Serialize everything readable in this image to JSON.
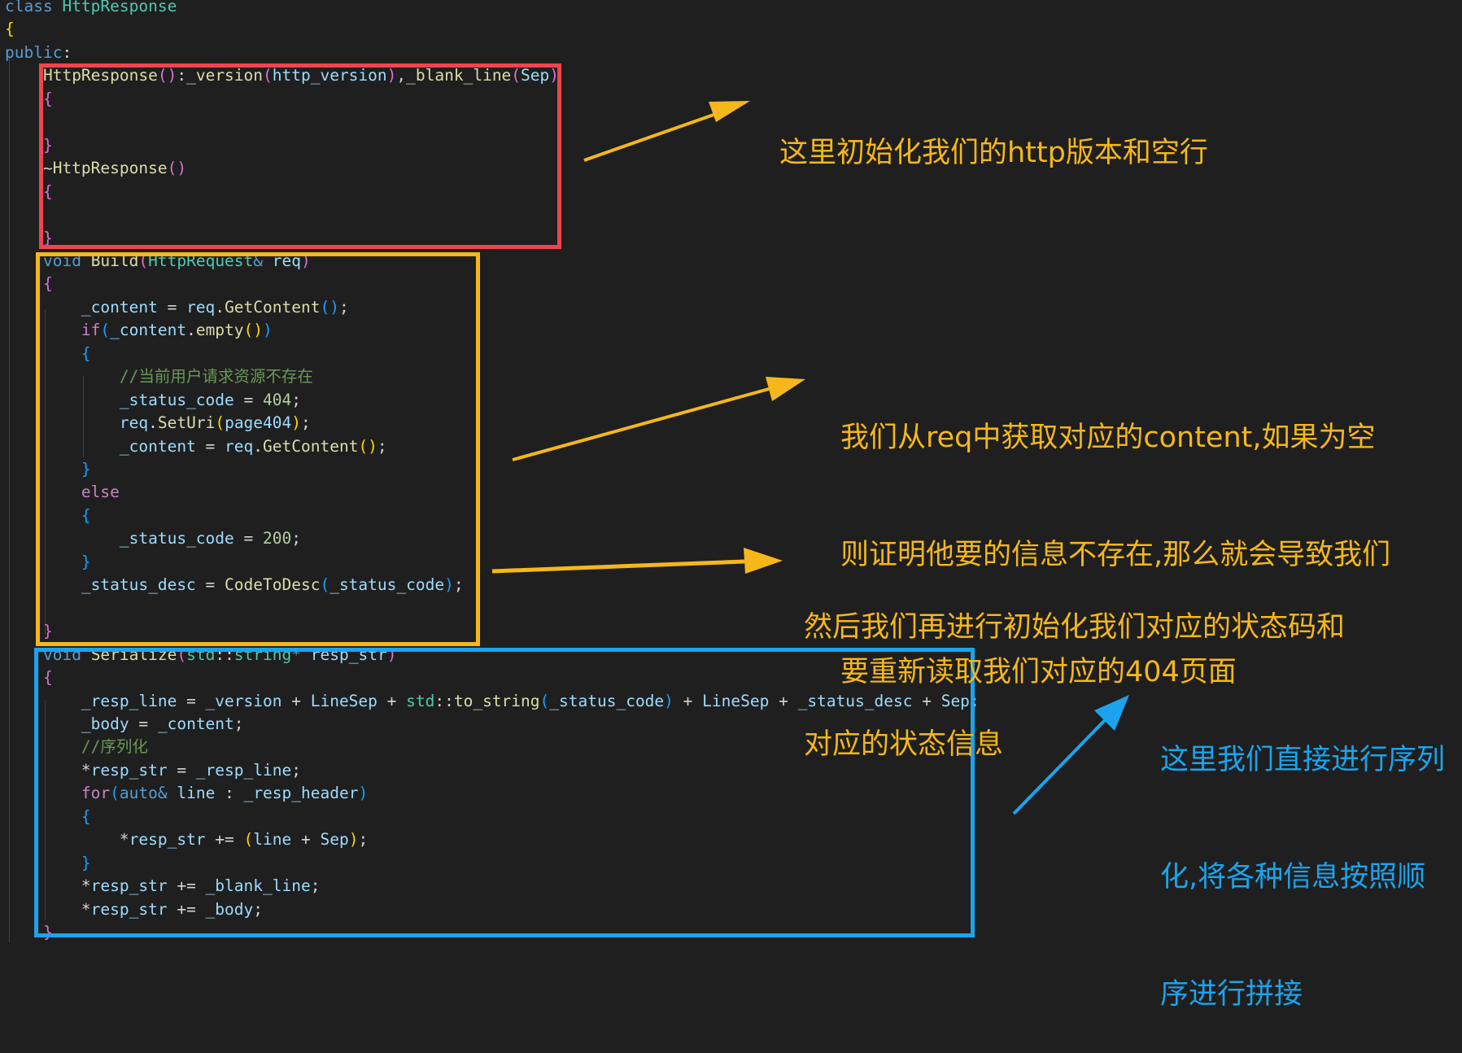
{
  "editor": {
    "theme_colors": {
      "background": "#1f1f1f",
      "keyword": "#569cd6",
      "control": "#c586c0",
      "type": "#4ec9b0",
      "function": "#dcdcaa",
      "variable": "#9cdcfe",
      "number": "#b5cea8",
      "comment": "#6a9955",
      "bracket_gold": "#ffd700",
      "bracket_orchid": "#da70d6",
      "bracket_blue": "#179fff"
    },
    "lines": [
      [
        [
          "kw",
          "class"
        ],
        [
          "pl",
          " "
        ],
        [
          "ty",
          "HttpResponse"
        ]
      ],
      [
        [
          "br1",
          "{"
        ]
      ],
      [
        [
          "kw",
          "public"
        ],
        [
          "pl",
          ":"
        ]
      ],
      [
        [
          "pl",
          "    "
        ],
        [
          "fn",
          "HttpResponse"
        ],
        [
          "br2",
          "()"
        ],
        [
          "pl",
          ":"
        ],
        [
          "fn",
          "_version"
        ],
        [
          "br2",
          "("
        ],
        [
          "var",
          "http_version"
        ],
        [
          "br2",
          ")"
        ],
        [
          "pl",
          ","
        ],
        [
          "fn",
          "_blank_line"
        ],
        [
          "br2",
          "("
        ],
        [
          "var",
          "Sep"
        ],
        [
          "br2",
          ")"
        ]
      ],
      [
        [
          "pl",
          "    "
        ],
        [
          "br2",
          "{"
        ]
      ],
      [
        [
          "pl",
          ""
        ]
      ],
      [
        [
          "pl",
          "    "
        ],
        [
          "br2",
          "}"
        ]
      ],
      [
        [
          "pl",
          "    ~"
        ],
        [
          "fn",
          "HttpResponse"
        ],
        [
          "br2",
          "()"
        ]
      ],
      [
        [
          "pl",
          "    "
        ],
        [
          "br2",
          "{"
        ]
      ],
      [
        [
          "pl",
          ""
        ]
      ],
      [
        [
          "pl",
          "    "
        ],
        [
          "br2",
          "}"
        ]
      ],
      [
        [
          "pl",
          "    "
        ],
        [
          "kw",
          "void"
        ],
        [
          "pl",
          " "
        ],
        [
          "fn",
          "Build"
        ],
        [
          "br2",
          "("
        ],
        [
          "ty",
          "HttpRequest"
        ],
        [
          "kw",
          "&"
        ],
        [
          "pl",
          " "
        ],
        [
          "var",
          "req"
        ],
        [
          "br2",
          ")"
        ]
      ],
      [
        [
          "pl",
          "    "
        ],
        [
          "br2",
          "{"
        ]
      ],
      [
        [
          "pl",
          "        "
        ],
        [
          "var",
          "_content"
        ],
        [
          "pl",
          " = "
        ],
        [
          "var",
          "req"
        ],
        [
          "pl",
          "."
        ],
        [
          "fn",
          "GetContent"
        ],
        [
          "br3",
          "()"
        ],
        [
          "pl",
          ";"
        ]
      ],
      [
        [
          "pl",
          "        "
        ],
        [
          "kw2",
          "if"
        ],
        [
          "br3",
          "("
        ],
        [
          "var",
          "_content"
        ],
        [
          "pl",
          "."
        ],
        [
          "fn",
          "empty"
        ],
        [
          "br1",
          "()"
        ],
        [
          "br3",
          ")"
        ]
      ],
      [
        [
          "pl",
          "        "
        ],
        [
          "br3",
          "{"
        ]
      ],
      [
        [
          "pl",
          "            "
        ],
        [
          "cmt",
          "//当前用户请求资源不存在"
        ]
      ],
      [
        [
          "pl",
          "            "
        ],
        [
          "var",
          "_status_code"
        ],
        [
          "pl",
          " = "
        ],
        [
          "num",
          "404"
        ],
        [
          "pl",
          ";"
        ]
      ],
      [
        [
          "pl",
          "            "
        ],
        [
          "var",
          "req"
        ],
        [
          "pl",
          "."
        ],
        [
          "fn",
          "SetUri"
        ],
        [
          "br1",
          "("
        ],
        [
          "var",
          "page404"
        ],
        [
          "br1",
          ")"
        ],
        [
          "pl",
          ";"
        ]
      ],
      [
        [
          "pl",
          "            "
        ],
        [
          "var",
          "_content"
        ],
        [
          "pl",
          " = "
        ],
        [
          "var",
          "req"
        ],
        [
          "pl",
          "."
        ],
        [
          "fn",
          "GetContent"
        ],
        [
          "br1",
          "()"
        ],
        [
          "pl",
          ";"
        ]
      ],
      [
        [
          "pl",
          "        "
        ],
        [
          "br3",
          "}"
        ]
      ],
      [
        [
          "pl",
          "        "
        ],
        [
          "kw2",
          "else"
        ]
      ],
      [
        [
          "pl",
          "        "
        ],
        [
          "br3",
          "{"
        ]
      ],
      [
        [
          "pl",
          "            "
        ],
        [
          "var",
          "_status_code"
        ],
        [
          "pl",
          " = "
        ],
        [
          "num",
          "200"
        ],
        [
          "pl",
          ";"
        ]
      ],
      [
        [
          "pl",
          "        "
        ],
        [
          "br3",
          "}"
        ]
      ],
      [
        [
          "pl",
          "        "
        ],
        [
          "var",
          "_status_desc"
        ],
        [
          "pl",
          " = "
        ],
        [
          "fn",
          "CodeToDesc"
        ],
        [
          "br3",
          "("
        ],
        [
          "var",
          "_status_code"
        ],
        [
          "br3",
          ")"
        ],
        [
          "pl",
          ";"
        ]
      ],
      [
        [
          "pl",
          ""
        ]
      ],
      [
        [
          "pl",
          "    "
        ],
        [
          "br2",
          "}"
        ]
      ],
      [
        [
          "pl",
          "    "
        ],
        [
          "kw",
          "void"
        ],
        [
          "pl",
          " "
        ],
        [
          "fn",
          "Serialize"
        ],
        [
          "br2",
          "("
        ],
        [
          "ty",
          "std"
        ],
        [
          "pl",
          "::"
        ],
        [
          "ty",
          "string"
        ],
        [
          "kw",
          "*"
        ],
        [
          "pl",
          " "
        ],
        [
          "var",
          "resp_str"
        ],
        [
          "br2",
          ")"
        ]
      ],
      [
        [
          "pl",
          "    "
        ],
        [
          "br2",
          "{"
        ]
      ],
      [
        [
          "pl",
          "        "
        ],
        [
          "var",
          "_resp_line"
        ],
        [
          "pl",
          " = "
        ],
        [
          "var",
          "_version"
        ],
        [
          "pl",
          " + "
        ],
        [
          "var",
          "LineSep"
        ],
        [
          "pl",
          " + "
        ],
        [
          "ty",
          "std"
        ],
        [
          "pl",
          "::"
        ],
        [
          "fn",
          "to_string"
        ],
        [
          "br3",
          "("
        ],
        [
          "var",
          "_status_code"
        ],
        [
          "br3",
          ")"
        ],
        [
          "pl",
          " + "
        ],
        [
          "var",
          "LineSep"
        ],
        [
          "pl",
          " + "
        ],
        [
          "var",
          "_status_desc"
        ],
        [
          "pl",
          " + "
        ],
        [
          "var",
          "Sep"
        ],
        [
          "pl",
          ";"
        ]
      ],
      [
        [
          "pl",
          "        "
        ],
        [
          "var",
          "_body"
        ],
        [
          "pl",
          " = "
        ],
        [
          "var",
          "_content"
        ],
        [
          "pl",
          ";"
        ]
      ],
      [
        [
          "pl",
          "        "
        ],
        [
          "cmt",
          "//序列化"
        ]
      ],
      [
        [
          "pl",
          "        *"
        ],
        [
          "var",
          "resp_str"
        ],
        [
          "pl",
          " = "
        ],
        [
          "var",
          "_resp_line"
        ],
        [
          "pl",
          ";"
        ]
      ],
      [
        [
          "pl",
          "        "
        ],
        [
          "kw2",
          "for"
        ],
        [
          "br3",
          "("
        ],
        [
          "kw",
          "auto"
        ],
        [
          "kw",
          "&"
        ],
        [
          "pl",
          " "
        ],
        [
          "var",
          "line"
        ],
        [
          "pl",
          " : "
        ],
        [
          "var",
          "_resp_header"
        ],
        [
          "br3",
          ")"
        ]
      ],
      [
        [
          "pl",
          "        "
        ],
        [
          "br3",
          "{"
        ]
      ],
      [
        [
          "pl",
          "            *"
        ],
        [
          "var",
          "resp_str"
        ],
        [
          "pl",
          " += "
        ],
        [
          "br1",
          "("
        ],
        [
          "var",
          "line"
        ],
        [
          "pl",
          " + "
        ],
        [
          "var",
          "Sep"
        ],
        [
          "br1",
          ")"
        ],
        [
          "pl",
          ";"
        ]
      ],
      [
        [
          "pl",
          "        "
        ],
        [
          "br3",
          "}"
        ]
      ],
      [
        [
          "pl",
          "        *"
        ],
        [
          "var",
          "resp_str"
        ],
        [
          "pl",
          " += "
        ],
        [
          "var",
          "_blank_line"
        ],
        [
          "pl",
          ";"
        ]
      ],
      [
        [
          "pl",
          "        *"
        ],
        [
          "var",
          "resp_str"
        ],
        [
          "pl",
          " += "
        ],
        [
          "var",
          "_body"
        ],
        [
          "pl",
          ";"
        ]
      ],
      [
        [
          "pl",
          "    "
        ],
        [
          "br2",
          "}"
        ]
      ]
    ]
  },
  "annotations": {
    "colors": {
      "red_box": "#f0454f",
      "yellow": "#f5b71a",
      "blue": "#1aa4ee"
    },
    "constructor_note": "这里初始化我们的http版本和空行",
    "build_note": [
      "我们从req中获取对应的content,如果为空",
      "则证明他要的信息不存在,那么就会导致我们",
      "要重新读取我们对应的404页面"
    ],
    "status_note": [
      "然后我们再进行初始化我们对应的状态码和",
      "对应的状态信息"
    ],
    "serialize_note": [
      "这里我们直接进行序列",
      "化,将各种信息按照顺",
      "序进行拼接"
    ]
  }
}
